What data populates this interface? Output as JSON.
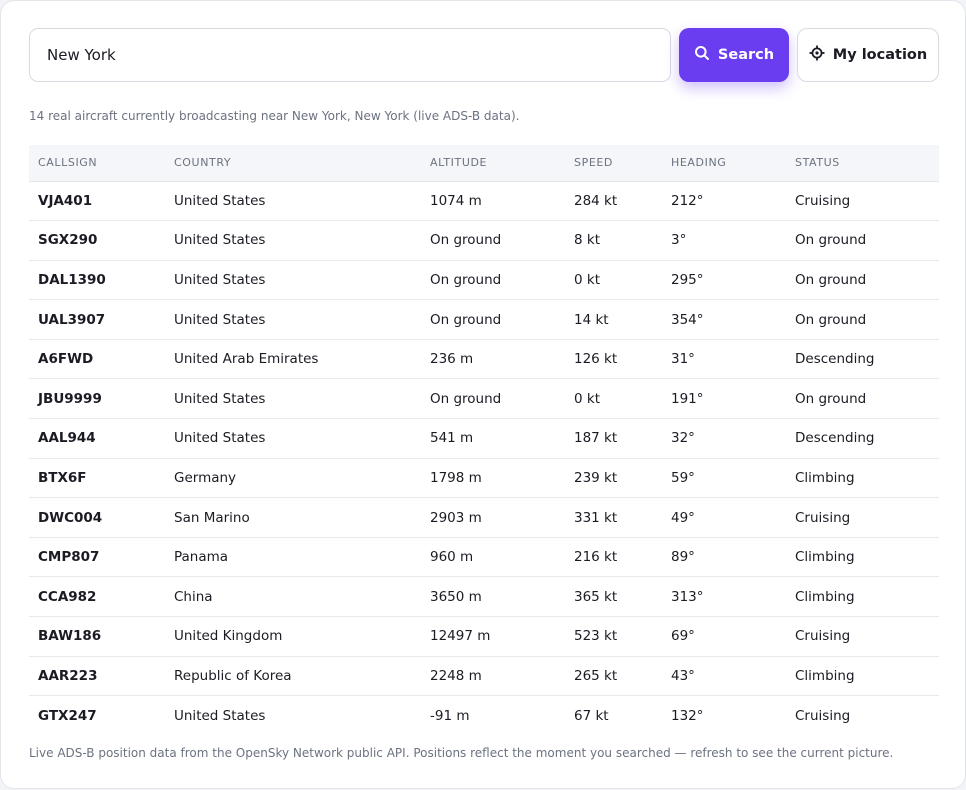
{
  "search": {
    "value": "New York",
    "search_label": "Search",
    "location_label": "My location"
  },
  "summary": "14 real aircraft currently broadcasting near New York, New York (live ADS-B data).",
  "table": {
    "headers": [
      "CALLSIGN",
      "COUNTRY",
      "ALTITUDE",
      "SPEED",
      "HEADING",
      "STATUS"
    ],
    "rows": [
      [
        "VJA401",
        "United States",
        "1074 m",
        "284 kt",
        "212°",
        "Cruising"
      ],
      [
        "SGX290",
        "United States",
        "On ground",
        "8 kt",
        "3°",
        "On ground"
      ],
      [
        "DAL1390",
        "United States",
        "On ground",
        "0 kt",
        "295°",
        "On ground"
      ],
      [
        "UAL3907",
        "United States",
        "On ground",
        "14 kt",
        "354°",
        "On ground"
      ],
      [
        "A6FWD",
        "United Arab Emirates",
        "236 m",
        "126 kt",
        "31°",
        "Descending"
      ],
      [
        "JBU9999",
        "United States",
        "On ground",
        "0 kt",
        "191°",
        "On ground"
      ],
      [
        "AAL944",
        "United States",
        "541 m",
        "187 kt",
        "32°",
        "Descending"
      ],
      [
        "BTX6F",
        "Germany",
        "1798 m",
        "239 kt",
        "59°",
        "Climbing"
      ],
      [
        "DWC004",
        "San Marino",
        "2903 m",
        "331 kt",
        "49°",
        "Cruising"
      ],
      [
        "CMP807",
        "Panama",
        "960 m",
        "216 kt",
        "89°",
        "Climbing"
      ],
      [
        "CCA982",
        "China",
        "3650 m",
        "365 kt",
        "313°",
        "Climbing"
      ],
      [
        "BAW186",
        "United Kingdom",
        "12497 m",
        "523 kt",
        "69°",
        "Cruising"
      ],
      [
        "AAR223",
        "Republic of Korea",
        "2248 m",
        "265 kt",
        "43°",
        "Climbing"
      ],
      [
        "GTX247",
        "United States",
        "-91 m",
        "67 kt",
        "132°",
        "Cruising"
      ]
    ]
  },
  "footnote": "Live ADS-B position data from the OpenSky Network public API. Positions reflect the moment you searched — refresh to see the current picture.",
  "colors": {
    "accent": "#6a3df0",
    "text": "#1b1b24",
    "muted": "#6b7280"
  },
  "icons": {
    "search_button": "search-icon",
    "location_button": "crosshair-icon"
  }
}
